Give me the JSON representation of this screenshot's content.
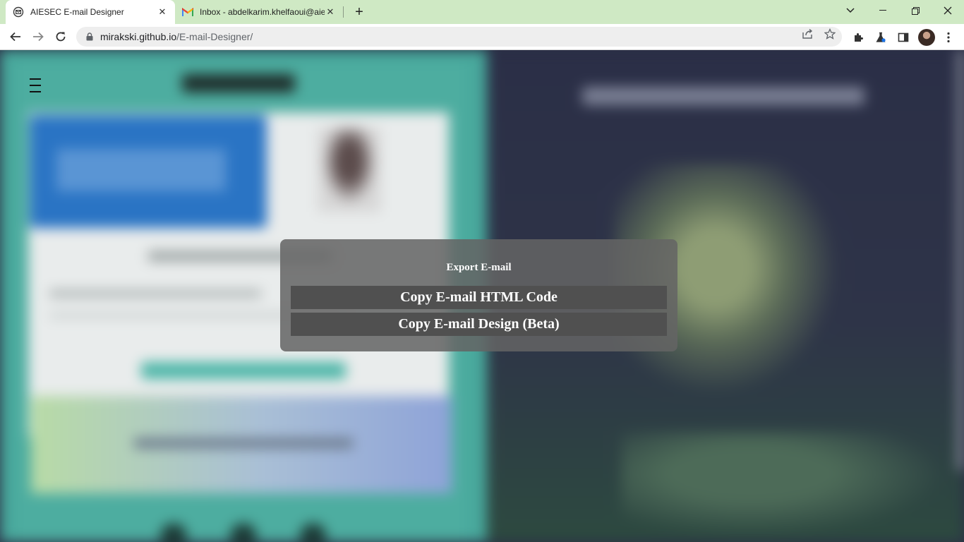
{
  "browser": {
    "tabs": [
      {
        "title": "AIESEC E-mail Designer",
        "favicon": "email-favicon",
        "active": true
      },
      {
        "title": "Inbox - abdelkarim.khelfaoui@aiesec",
        "favicon": "gmail-favicon",
        "active": false
      }
    ],
    "url": {
      "host": "mirakski.github.io",
      "path": "/E-mail-Designer/"
    }
  },
  "page": {
    "menu_icon": "hamburger-icon"
  },
  "dialog": {
    "title": "Export E-mail",
    "copy_html_label": "Copy E-mail HTML Code",
    "copy_design_label": "Copy E-mail Design (Beta)"
  },
  "colors": {
    "tabstrip": "#cfe9c4",
    "dialog_bg": "#646464",
    "dialog_button": "#505050",
    "page_left": "#48a89c",
    "page_right": "#2b2f46"
  }
}
